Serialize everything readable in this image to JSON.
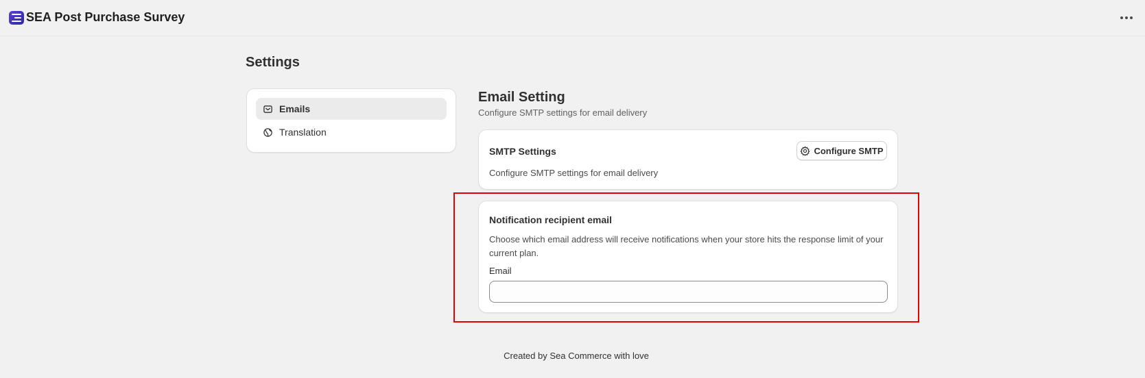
{
  "app": {
    "title": "SEA Post Purchase Survey",
    "logo_icon": "survey-logo-icon",
    "menu_icon": "more-horizontal-icon"
  },
  "page": {
    "title": "Settings"
  },
  "sidebar": {
    "items": [
      {
        "label": "Emails",
        "icon": "mail-icon",
        "active": true
      },
      {
        "label": "Translation",
        "icon": "globe-icon",
        "active": false
      }
    ]
  },
  "email_setting": {
    "title": "Email Setting",
    "subtitle": "Configure SMTP settings for email delivery"
  },
  "smtp_card": {
    "title": "SMTP Settings",
    "description": "Configure SMTP settings for email delivery",
    "button_label": "Configure SMTP",
    "button_icon": "gear-icon"
  },
  "notification_card": {
    "title": "Notification recipient email",
    "description": "Choose which email address will receive notifications when your store hits the response limit of your current plan.",
    "field_label": "Email",
    "field_value": "",
    "highlight_color": "#e00000"
  },
  "footer": {
    "text": "Created by Sea Commerce with love"
  }
}
